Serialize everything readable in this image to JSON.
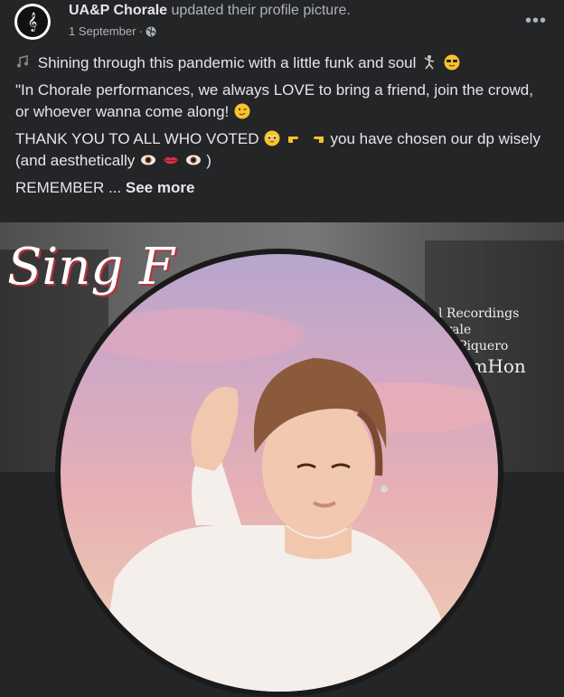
{
  "post": {
    "page_name": "UA&P Chorale",
    "action_text": "updated their profile picture.",
    "date": "1 September",
    "separator": "·",
    "privacy_icon": "globe-icon",
    "more_icon": "ellipsis-icon",
    "more_label": "•••"
  },
  "caption": {
    "line1_text": "Shining through this pandemic with a little funk and soul",
    "line2_text": "\"In Chorale performances, we always LOVE to bring a friend, join the crowd, or whoever wanna come along!",
    "line3_text_a": "THANK YOU TO ALL WHO VOTED",
    "line3_text_b": "you have chosen our dp wisely (and aesthetically",
    "line3_text_c": ")",
    "line4_text": "REMEMBER ...",
    "see_more": "See more"
  },
  "cover": {
    "script_text": "Sing F",
    "credit1": "l Recordings",
    "credit2": "orale",
    "credit3": "da-Piquero",
    "credit4": "FromHon"
  },
  "colors": {
    "background": "#242526",
    "primary_text": "#e4e6eb",
    "secondary_text": "#b0b3b8"
  }
}
